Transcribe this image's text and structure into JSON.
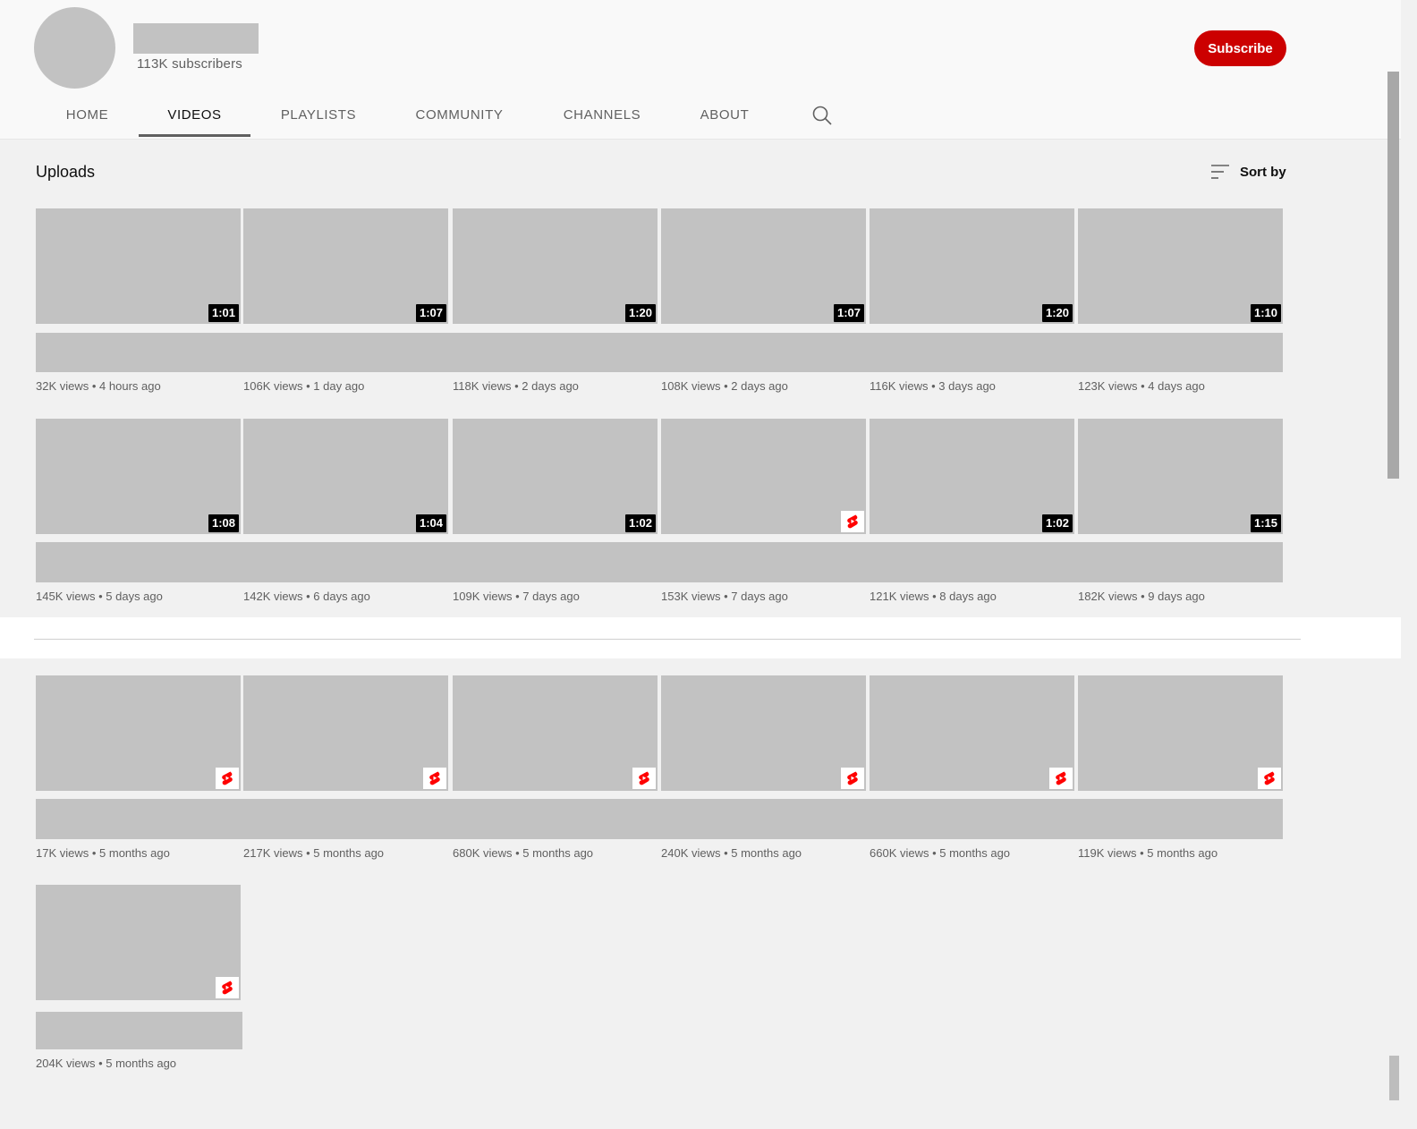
{
  "channel": {
    "subscribers": "113K subscribers",
    "subscribe_label": "Subscribe"
  },
  "tabs": [
    {
      "label": "HOME",
      "active": false
    },
    {
      "label": "VIDEOS",
      "active": true
    },
    {
      "label": "PLAYLISTS",
      "active": false
    },
    {
      "label": "COMMUNITY",
      "active": false
    },
    {
      "label": "CHANNELS",
      "active": false
    },
    {
      "label": "ABOUT",
      "active": false
    }
  ],
  "tab_search_icon": "search-icon",
  "section": {
    "title": "Uploads",
    "sort_label": "Sort by",
    "sort_icon": "sort-icon"
  },
  "colors": {
    "subscribe": "#cc0000",
    "placeholder": "#c2c2c2",
    "shorts": "#ff0000"
  },
  "videos_upper": [
    {
      "duration": "1:01",
      "views": "32K views",
      "age": "4 hours ago"
    },
    {
      "duration": "1:07",
      "views": "106K views",
      "age": "1 day ago"
    },
    {
      "duration": "1:20",
      "views": "118K views",
      "age": "2 days ago"
    },
    {
      "duration": "1:07",
      "views": "108K views",
      "age": "2 days ago"
    },
    {
      "duration": "1:20",
      "views": "116K views",
      "age": "3 days ago"
    },
    {
      "duration": "1:10",
      "views": "123K views",
      "age": "4 days ago"
    },
    {
      "duration": "1:08",
      "views": "145K views",
      "age": "5 days ago"
    },
    {
      "duration": "1:04",
      "views": "142K views",
      "age": "6 days ago"
    },
    {
      "duration": "1:02",
      "views": "109K views",
      "age": "7 days ago"
    },
    {
      "duration": "",
      "shorts": true,
      "views": "153K views",
      "age": "7 days ago"
    },
    {
      "duration": "1:02",
      "views": "121K views",
      "age": "8 days ago"
    },
    {
      "duration": "1:15",
      "views": "182K views",
      "age": "9 days ago"
    }
  ],
  "videos_lower": [
    {
      "shorts": true,
      "views": "17K views",
      "age": "5 months ago"
    },
    {
      "shorts": true,
      "views": "217K views",
      "age": "5 months ago"
    },
    {
      "shorts": true,
      "views": "680K views",
      "age": "5 months ago"
    },
    {
      "shorts": true,
      "views": "240K views",
      "age": "5 months ago"
    },
    {
      "shorts": true,
      "views": "660K views",
      "age": "5 months ago"
    },
    {
      "shorts": true,
      "views": "119K views",
      "age": "5 months ago"
    },
    {
      "shorts": true,
      "views": "204K views",
      "age": "5 months ago"
    }
  ]
}
